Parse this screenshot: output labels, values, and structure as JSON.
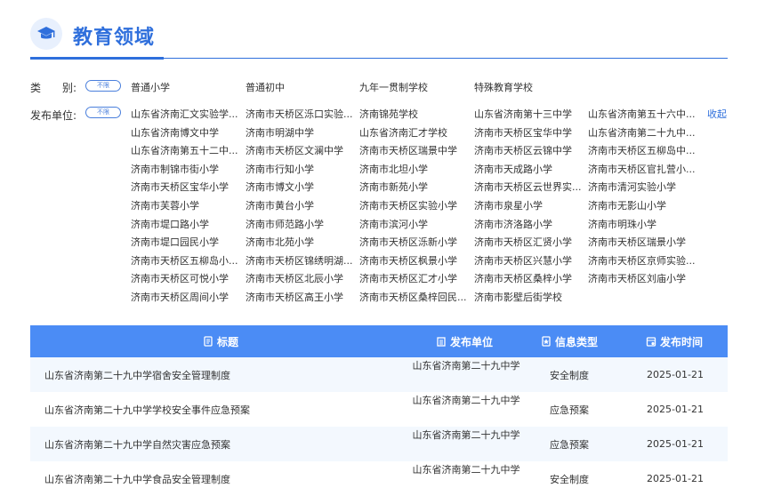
{
  "header": {
    "title": "教育领域"
  },
  "filters": {
    "category": {
      "label": "类　　别:",
      "tag": "不限",
      "options": [
        "普通小学",
        "普通初中",
        "九年一贯制学校",
        "特殊教育学校"
      ]
    },
    "publisher": {
      "label": "发布单位:",
      "tag": "不限",
      "collapse": "收起",
      "options": [
        "山东省济南汇文实验学...",
        "济南市天桥区泺口实验...",
        "济南锦苑学校",
        "山东省济南第十三中学",
        "山东省济南第五十六中...",
        "山东省济南博文中学",
        "济南市明湖中学",
        "山东省济南汇才学校",
        "济南市天桥区宝华中学",
        "山东省济南第二十九中...",
        "山东省济南第五十二中...",
        "济南市天桥区文澜中学",
        "济南市天桥区瑞景中学",
        "济南市天桥区云锦中学",
        "济南市天桥区五柳岛中...",
        "济南市制锦市街小学",
        "济南市行知小学",
        "济南市北坦小学",
        "济南市天成路小学",
        "济南市天桥区官扎营小...",
        "济南市天桥区宝华小学",
        "济南市博文小学",
        "济南市新苑小学",
        "济南市天桥区云世界实...",
        "济南市清河实验小学",
        "济南市芙蓉小学",
        "济南市黄台小学",
        "济南市天桥区实验小学",
        "济南市泉星小学",
        "济南市无影山小学",
        "济南市堤口路小学",
        "济南市师范路小学",
        "济南市滨河小学",
        "济南市济洛路小学",
        "济南市明珠小学",
        "济南市堤口园民小学",
        "济南市北苑小学",
        "济南市天桥区泺新小学",
        "济南市天桥区汇贤小学",
        "济南市天桥区瑞景小学",
        "济南市天桥区五柳岛小...",
        "济南市天桥区锦绣明湖...",
        "济南市天桥区枫景小学",
        "济南市天桥区兴慧小学",
        "济南市天桥区京师实验...",
        "济南市天桥区可悦小学",
        "济南市天桥区北辰小学",
        "济南市天桥区汇才小学",
        "济南市天桥区桑梓小学",
        "济南市天桥区刘庙小学",
        "济南市天桥区周间小学",
        "济南市天桥区高王小学",
        "济南市天桥区桑梓回民...",
        "济南市影壁后街学校"
      ]
    }
  },
  "table": {
    "headers": {
      "title": "标题",
      "unit": "发布单位",
      "type": "信息类型",
      "date": "发布时间"
    },
    "rows": [
      {
        "title": "山东省济南第二十九中学宿舍安全管理制度",
        "unit": "山东省济南第二十九中学",
        "type": "安全制度",
        "date": "2025-01-21"
      },
      {
        "title": "山东省济南第二十九中学学校安全事件应急预案",
        "unit": "山东省济南第二十九中学",
        "type": "应急预案",
        "date": "2025-01-21"
      },
      {
        "title": "山东省济南第二十九中学自然灾害应急预案",
        "unit": "山东省济南第二十九中学",
        "type": "应急预案",
        "date": "2025-01-21"
      },
      {
        "title": "山东省济南第二十九中学食品安全管理制度",
        "unit": "山东省济南第二十九中学",
        "type": "安全制度",
        "date": "2025-01-21"
      }
    ]
  },
  "colors": {
    "accent": "#2f6fdc",
    "table_header": "#4b8cf5",
    "row_alt": "#f3f8fe"
  }
}
